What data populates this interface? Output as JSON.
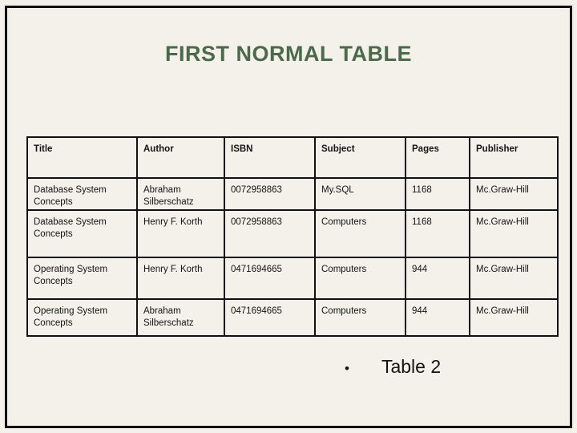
{
  "slide": {
    "title": "FIRST NORMAL TABLE",
    "title_color": "#4a6a4a",
    "background_color": "#f4f1ea",
    "border_color": "#111111"
  },
  "table": {
    "headers": [
      "Title",
      "Author",
      "ISBN",
      "Subject",
      "Pages",
      "Publisher"
    ],
    "rows": [
      {
        "title": "Database System Concepts",
        "author": "Abraham Silberschatz",
        "isbn": "0072958863",
        "subject": "My.SQL",
        "pages": "1168",
        "publisher": "Mc.Graw-Hill"
      },
      {
        "title": "Database System Concepts",
        "author": "Henry F. Korth",
        "isbn": "0072958863",
        "subject": "Computers",
        "pages": "1168",
        "publisher": "Mc.Graw-Hill"
      },
      {
        "title": "Operating System Concepts",
        "author": "Henry F. Korth",
        "isbn": "0471694665",
        "subject": "Computers",
        "pages": "944",
        "publisher": "Mc.Graw-Hill"
      },
      {
        "title": "Operating System Concepts",
        "author": "Abraham Silberschatz",
        "isbn": "0471694665",
        "subject": "Computers",
        "pages": "944",
        "publisher": "Mc.Graw-Hill"
      }
    ]
  },
  "caption": {
    "bullet": "•",
    "text": "Table 2"
  }
}
